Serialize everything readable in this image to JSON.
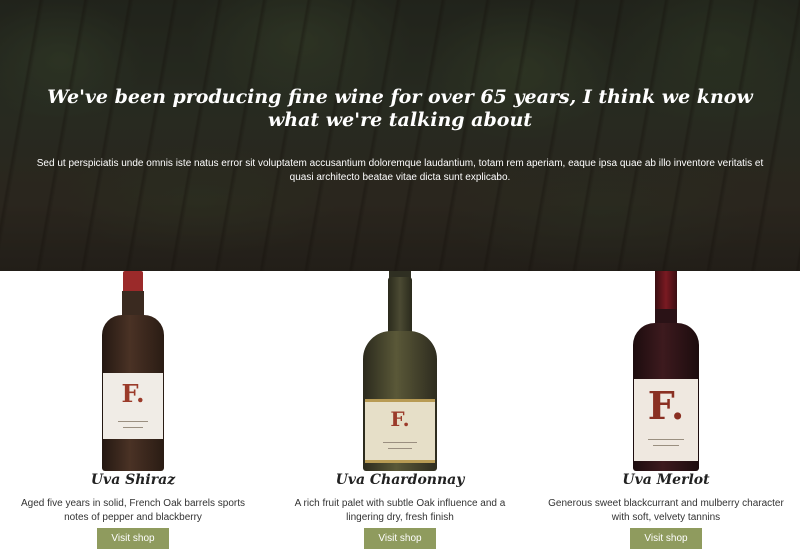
{
  "hero": {
    "title": "We've been producing fine wine for over 65 years, I think we know what we're talking about",
    "text": "Sed ut perspiciatis unde omnis iste natus error sit voluptatem accusantium doloremque laudantium, totam rem aperiam, eaque ipsa quae ab illo inventore veritatis et quasi architecto beatae vitae dicta sunt explicabo."
  },
  "products": [
    {
      "name": "Uva Shiraz",
      "description": "Aged five years in solid, French Oak barrels sports notes of pepper and blackberry",
      "button": "Visit shop",
      "label_mark": "F."
    },
    {
      "name": "Uva Chardonnay",
      "description": "A rich fruit palet with subtle Oak influence and a lingering dry, fresh finish",
      "button": "Visit shop",
      "label_mark": "F."
    },
    {
      "name": "Uva Merlot",
      "description": "Generous sweet blackcurrant and mulberry character with soft, velvety tannins",
      "button": "Visit shop",
      "label_mark": "F."
    }
  ],
  "colors": {
    "button_bg": "#8f9b5e",
    "hero_overlay": "#2b2f24",
    "label_mark": "#9b3b2a"
  }
}
